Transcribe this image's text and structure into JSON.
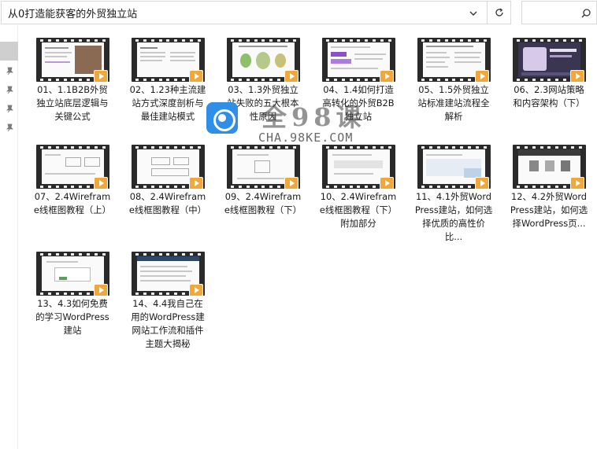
{
  "address_bar": {
    "path": "从0打造能获客的外贸独立站"
  },
  "search": {
    "placeholder": ""
  },
  "watermark": {
    "name": "全98课",
    "url": "CHA.98KE.COM"
  },
  "files": [
    {
      "caption": "01、1.1B2B外贸独立站底层逻辑与关键公式"
    },
    {
      "caption": "02、1.23种主流建站方式深度剖析与最佳建站模式"
    },
    {
      "caption": "03、1.3外贸独立站失败的五大根本性原因"
    },
    {
      "caption": "04、1.4如何打造高转化的外贸B2B独立站"
    },
    {
      "caption": "05、1.5外贸独立站标准建站流程全解析"
    },
    {
      "caption": "06、2.3网站策略和内容架构（下）"
    },
    {
      "caption": "07、2.4Wireframe线框图教程（上）"
    },
    {
      "caption": "08、2.4Wireframe线框图教程（中）"
    },
    {
      "caption": "09、2.4Wireframe线框图教程（下）"
    },
    {
      "caption": "10、2.4Wireframe线框图教程（下）附加部分"
    },
    {
      "caption": "11、4.1外贸WordPress建站，如何选择优质的高性价比..."
    },
    {
      "caption": "12、4.2外贸WordPress建站，如何选择WordPress页..."
    },
    {
      "caption": "13、4.3如何免费的学习WordPress建站"
    },
    {
      "caption": "14、4.4我自己在用的WordPress建网站工作流和插件主题大揭秘"
    }
  ],
  "colors": {
    "play_badge": "#f0a83a",
    "film": "#2a2a2a",
    "selection": "#cfcfcf"
  }
}
